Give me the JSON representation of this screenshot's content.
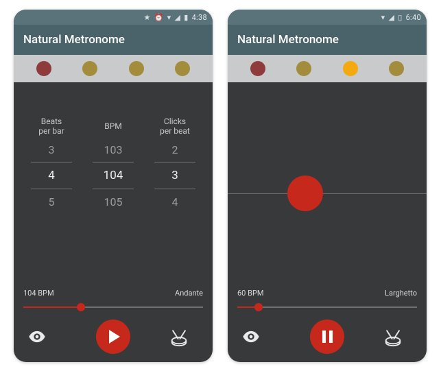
{
  "screens": [
    {
      "status": {
        "extra_icons": [
          "star",
          "alarm",
          "wifi",
          "signal",
          "battery"
        ],
        "time": "4:38"
      },
      "app_title": "Natural Metronome",
      "beats": [
        "maroon",
        "olive",
        "olive",
        "olive"
      ],
      "pickers": {
        "beats_per_bar": {
          "label": "Beats\nper bar",
          "prev": "3",
          "sel": "4",
          "next": "5"
        },
        "bpm": {
          "label": "BPM",
          "prev": "103",
          "sel": "104",
          "next": "105"
        },
        "clicks_per_beat": {
          "label": "Clicks\nper beat",
          "prev": "2",
          "sel": "3",
          "next": "4"
        }
      },
      "tempo_label": "104 BPM",
      "tempo_name": "Andante",
      "slider_pct": 32,
      "playing": false
    },
    {
      "status": {
        "extra_icons": [
          "wifi",
          "signal",
          "battery"
        ],
        "time": "6:40"
      },
      "app_title": "Natural Metronome",
      "beats": [
        "maroon",
        "olive",
        "yellow",
        "olive"
      ],
      "bob_left_pct": 30,
      "tempo_label": "60 BPM",
      "tempo_name": "Larghetto",
      "slider_pct": 12,
      "playing": true
    }
  ]
}
